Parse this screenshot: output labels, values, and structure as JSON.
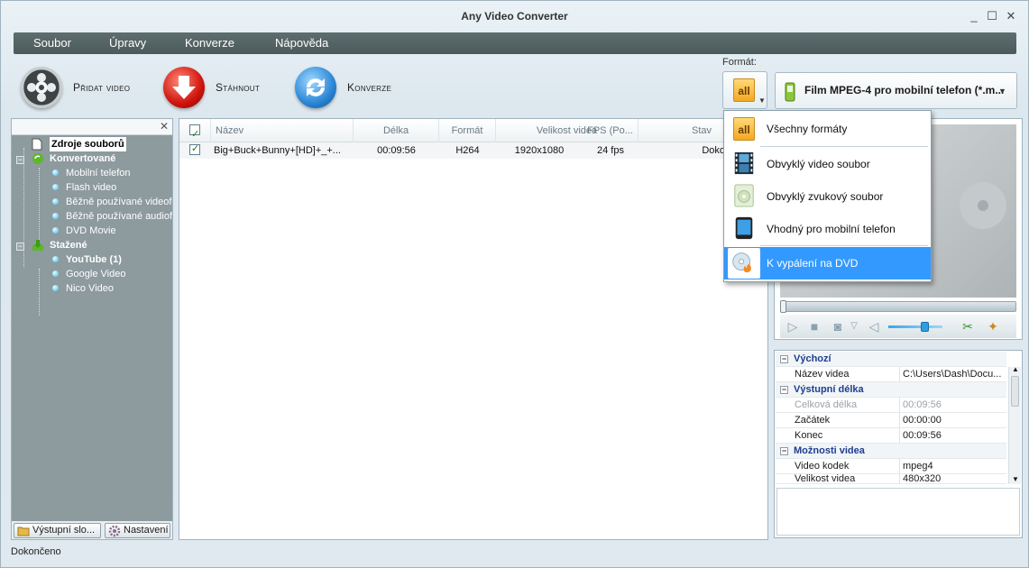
{
  "window": {
    "title": "Any Video Converter",
    "minimize": "_",
    "maximize": "☐",
    "close": "✕"
  },
  "menu": [
    "Soubor",
    "Úpravy",
    "Konverze",
    "Nápověda"
  ],
  "toolbar": {
    "add_video": "Přidat video",
    "download": "Stáhnout",
    "convert": "Konverze"
  },
  "format": {
    "label": "Formát:",
    "type_icon_text": "all",
    "selected": "Film MPEG-4 pro mobilní telefon (*.m...",
    "menu": [
      {
        "label": "Všechny formáty",
        "icon": "all-formats-icon"
      },
      {
        "label": "Obvyklý video soubor",
        "icon": "film-icon"
      },
      {
        "label": "Obvyklý zvukový soubor",
        "icon": "audio-file-icon"
      },
      {
        "label": "Vhodný pro mobilní telefon",
        "icon": "mobile-phone-icon"
      },
      {
        "label": "K vypálení na DVD",
        "icon": "dvd-burn-icon",
        "highlighted": true
      }
    ]
  },
  "left_panel": {
    "close": "✕",
    "tree": {
      "sources": "Zdroje souborů",
      "converted": {
        "label": "Konvertované",
        "items": [
          "Mobilní telefon",
          "Flash video",
          "Běžně používané videofo",
          "Běžně používané audiofo",
          "DVD Movie"
        ]
      },
      "downloaded": {
        "label": "Stažené",
        "items": [
          "YouTube (1)",
          "Google Video",
          "Nico Video"
        ]
      }
    },
    "footer": {
      "output_folder": "Výstupní slo...",
      "settings": "Nastavení"
    }
  },
  "file_list": {
    "columns": [
      "Název",
      "Délka",
      "Formát",
      "Velikost videa",
      "FPS (Po...",
      "Stav"
    ],
    "rows": [
      {
        "name": "Big+Buck+Bunny+[HD]+_+...",
        "length": "00:09:56",
        "format": "H264",
        "size": "1920x1080",
        "fps": "24 fps",
        "status": "Dokončeno"
      }
    ]
  },
  "properties": {
    "groups": [
      {
        "label": "Výchozí",
        "rows": [
          {
            "key": "Název videa",
            "value": "C:\\Users\\Dash\\Docu..."
          }
        ]
      },
      {
        "label": "Výstupní délka",
        "rows": [
          {
            "key": "Celková délka",
            "value": "00:09:56",
            "dim": true
          },
          {
            "key": "Začátek",
            "value": "00:00:00"
          },
          {
            "key": "Konec",
            "value": "00:09:56"
          }
        ]
      },
      {
        "label": "Možnosti videa",
        "rows": [
          {
            "key": "Video kodek",
            "value": "mpeg4"
          },
          {
            "key": "Velikost videa",
            "value": "480x320"
          }
        ]
      }
    ]
  },
  "status_bar": "Dokončeno",
  "colors": {
    "menubar": "#55636366",
    "highlight": "#3399ff",
    "tree_bg": "#8d9a9e",
    "category_text": "#1d3e8f"
  }
}
